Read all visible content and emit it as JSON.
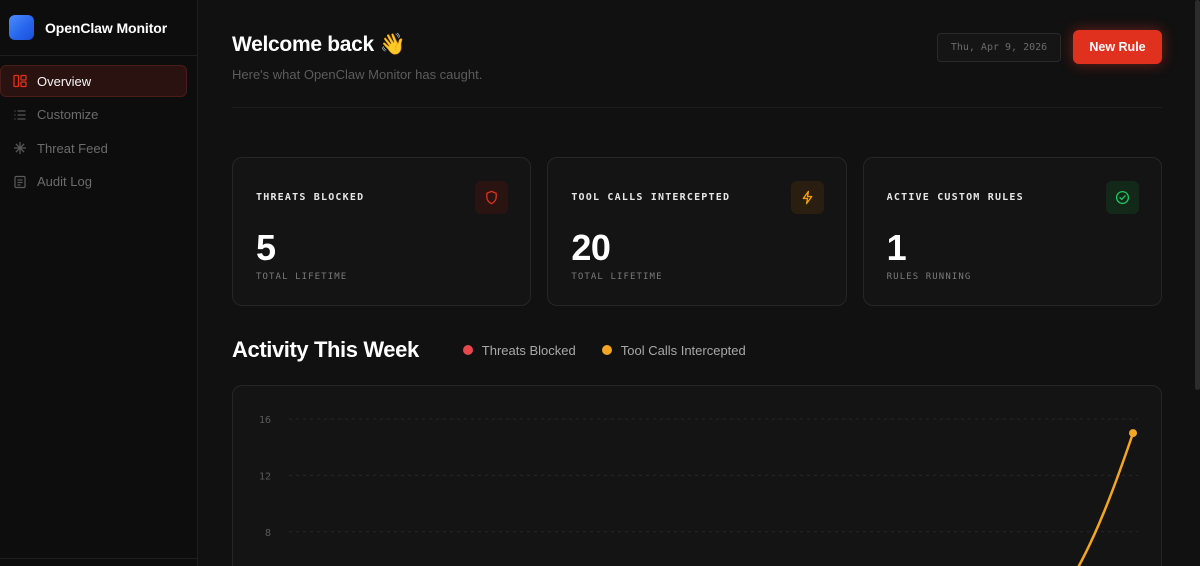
{
  "app": {
    "name": "OpenClaw Monitor"
  },
  "sidebar": {
    "items": [
      {
        "label": "Overview",
        "icon": "layout-icon",
        "active": true
      },
      {
        "label": "Customize",
        "icon": "list-icon",
        "active": false
      },
      {
        "label": "Threat Feed",
        "icon": "asterisk-icon",
        "active": false
      },
      {
        "label": "Audit Log",
        "icon": "document-icon",
        "active": false
      }
    ]
  },
  "header": {
    "welcome": "Welcome back 👋",
    "subtitle": "Here's what OpenClaw Monitor has caught.",
    "date": "Thu, Apr 9, 2026",
    "new_rule_label": "New Rule"
  },
  "stats": [
    {
      "title": "THREATS BLOCKED",
      "value": "5",
      "sub": "TOTAL LIFETIME",
      "icon": "shield-icon",
      "color": "#e0301e"
    },
    {
      "title": "TOOL CALLS INTERCEPTED",
      "value": "20",
      "sub": "TOTAL LIFETIME",
      "icon": "lightning-icon",
      "color": "#f59e0b"
    },
    {
      "title": "ACTIVE CUSTOM RULES",
      "value": "1",
      "sub": "RULES RUNNING",
      "icon": "check-circle-icon",
      "color": "#22c55e"
    }
  ],
  "activity": {
    "title": "Activity This Week",
    "legend": [
      {
        "label": "Threats Blocked",
        "color": "#e5484d"
      },
      {
        "label": "Tool Calls Intercepted",
        "color": "#f5a524"
      }
    ]
  },
  "chart_data": {
    "type": "line",
    "yticks": [
      "16",
      "12",
      "8"
    ],
    "ylim": [
      0,
      16
    ],
    "series": [
      {
        "name": "Tool Calls Intercepted",
        "color": "#f5a524",
        "last_value": 15
      }
    ]
  },
  "colors": {
    "accent": "#e0301e",
    "background": "#111111",
    "card": "#141414"
  }
}
